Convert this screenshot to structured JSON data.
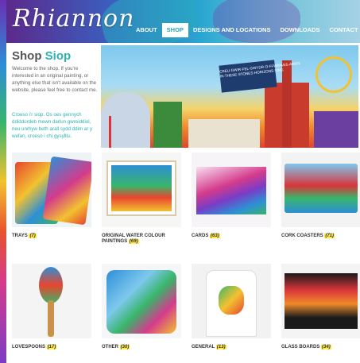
{
  "header": {
    "logo_text": "Rhiannon",
    "nav": [
      {
        "label": "ABOUT",
        "active": false
      },
      {
        "label": "SHOP",
        "active": true
      },
      {
        "label": "DESIGNS AND LOCATIONS",
        "active": false
      },
      {
        "label": "DOWNLOADS",
        "active": false
      },
      {
        "label": "CONTACT",
        "active": false
      }
    ]
  },
  "intro": {
    "title_en": "Shop",
    "title_cy": "Siop",
    "text_en": "Welcome to the shop. If you're interested in an original painting, or anything else that isn't available on the website, please feel free to contact me.",
    "text_cy": "Croeso i'r siop. Os oes gennych ddiddordeb mewn darlun gwreiddiol, neu unrhyw beth arall sydd ddim ar y wefan, croeso i chi gysylltu."
  },
  "banner": {
    "sign_lines": [
      "CREU·GWIR·FEL·GWYDR·O·FFWRNAIS·AWEN",
      "IN·THESE·STONES·HORIZONS·SING"
    ]
  },
  "products": [
    {
      "name": "TRAYS",
      "count": "(7)"
    },
    {
      "name": "ORIGINAL WATER COLOUR PAINTINGS",
      "name_line1": "ORIGINAL WATER COLOUR",
      "name_line2": "PAINTINGS",
      "count": "(69)"
    },
    {
      "name": "CARDS",
      "count": "(63)"
    },
    {
      "name": "CORK COASTERS",
      "count": "(71)"
    },
    {
      "name": "LOVESPOONS",
      "count": "(17)"
    },
    {
      "name": "OTHER",
      "count": "(30)"
    },
    {
      "name": "GENERAL",
      "count": "(13)"
    },
    {
      "name": "GLASS BOARDS",
      "count": "(34)"
    }
  ],
  "colors": {
    "accent": "#2ab3b1",
    "count_highlight": "#ffe94a",
    "nav_active_text": "#2aa6b8"
  }
}
